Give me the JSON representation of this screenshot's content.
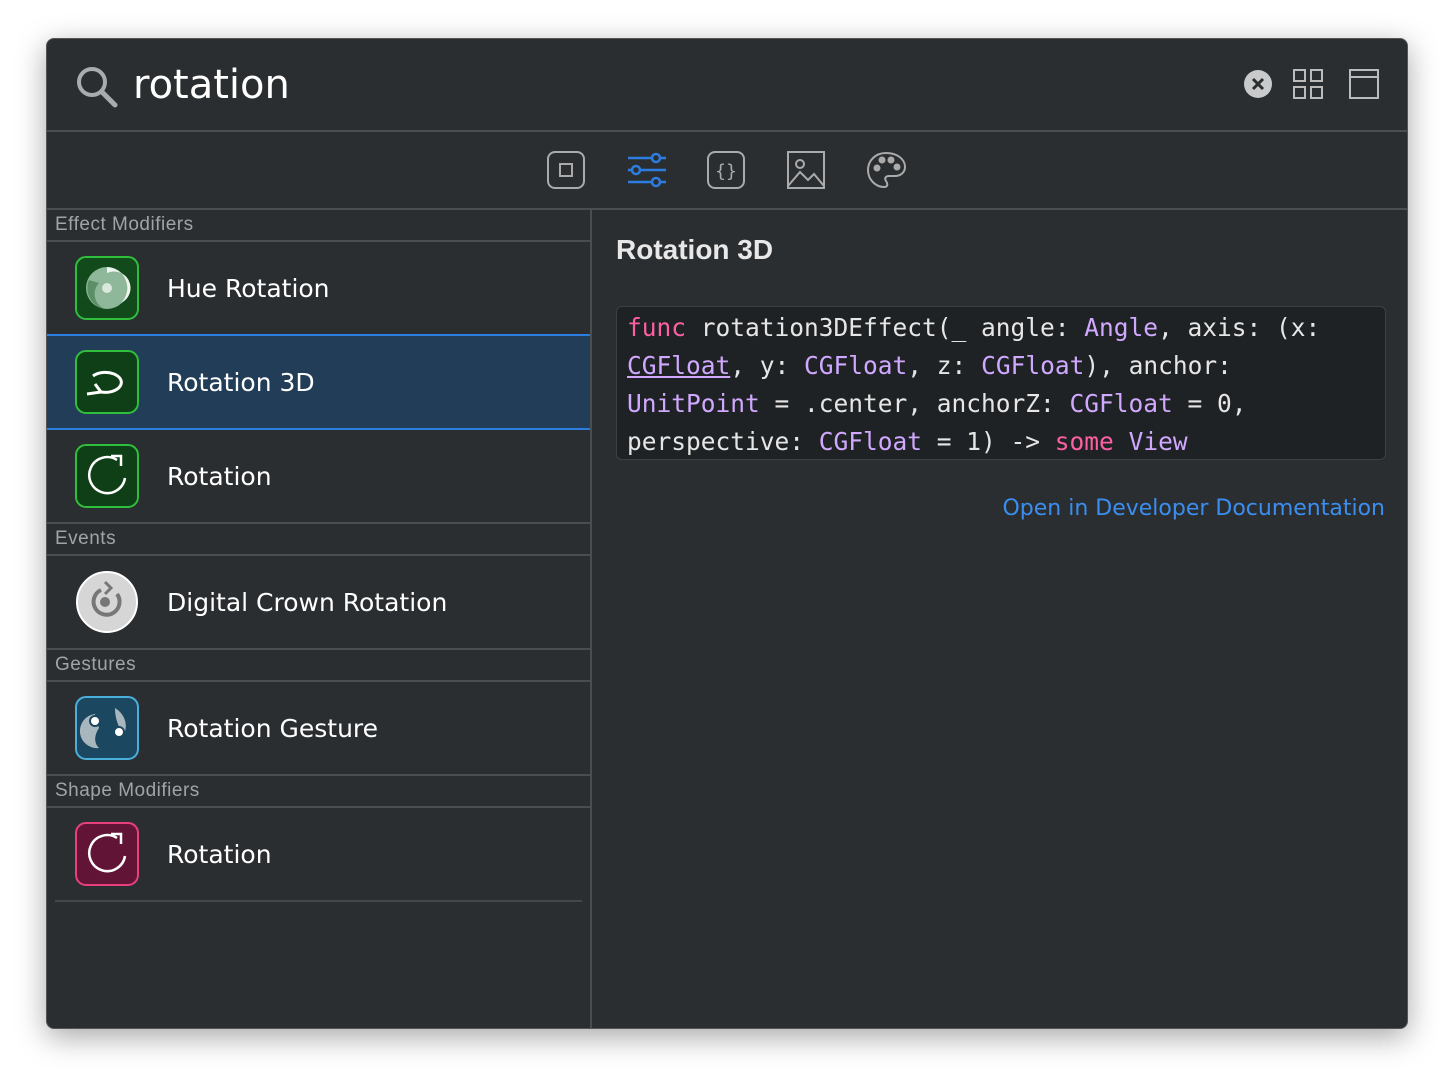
{
  "search": {
    "value": "rotation",
    "placeholder": ""
  },
  "toolbar": {
    "tabs": [
      {
        "name": "views"
      },
      {
        "name": "modifiers",
        "active": true
      },
      {
        "name": "snippets"
      },
      {
        "name": "media"
      },
      {
        "name": "colors"
      }
    ]
  },
  "sections": [
    {
      "title": "Effect Modifiers",
      "items": [
        {
          "label": "Hue Rotation",
          "icon": "hue-rotation-icon"
        },
        {
          "label": "Rotation 3D",
          "icon": "rotation-3d-icon",
          "selected": true
        },
        {
          "label": "Rotation",
          "icon": "rotation-icon"
        }
      ]
    },
    {
      "title": "Events",
      "items": [
        {
          "label": "Digital Crown Rotation",
          "icon": "digital-crown-icon"
        }
      ]
    },
    {
      "title": "Gestures",
      "items": [
        {
          "label": "Rotation Gesture",
          "icon": "rotation-gesture-icon"
        }
      ]
    },
    {
      "title": "Shape Modifiers",
      "items": [
        {
          "label": "Rotation",
          "icon": "shape-rotation-icon"
        }
      ]
    }
  ],
  "detail": {
    "title": "Rotation 3D",
    "code": [
      [
        "kw",
        "func"
      ],
      [
        "",
        "rotation3DEffect(_ angle: "
      ],
      [
        "ty",
        "Angle"
      ],
      [
        "",
        ", axis: (x: "
      ],
      [
        "ty ul",
        "CGFloat"
      ],
      [
        "",
        ", y: "
      ],
      [
        "ty",
        "CGFloat"
      ],
      [
        "",
        ", z: "
      ],
      [
        "ty",
        "CGFloat"
      ],
      [
        "",
        "), anchor: "
      ],
      [
        "ty",
        "UnitPoint"
      ],
      [
        "",
        " = .center, anchorZ: "
      ],
      [
        "ty",
        "CGFloat"
      ],
      [
        "",
        " = 0, perspective: "
      ],
      [
        "ty",
        "CGFloat"
      ],
      [
        "",
        " = 1) -> "
      ],
      [
        "kw",
        "some"
      ],
      [
        "",
        " "
      ],
      [
        "ty",
        "View"
      ]
    ],
    "link": "Open in Developer Documentation"
  },
  "colors": {
    "accent": "#2d7de0",
    "keyword": "#fc5fa3",
    "type": "#d0a8ff",
    "link": "#3b8ef0"
  }
}
